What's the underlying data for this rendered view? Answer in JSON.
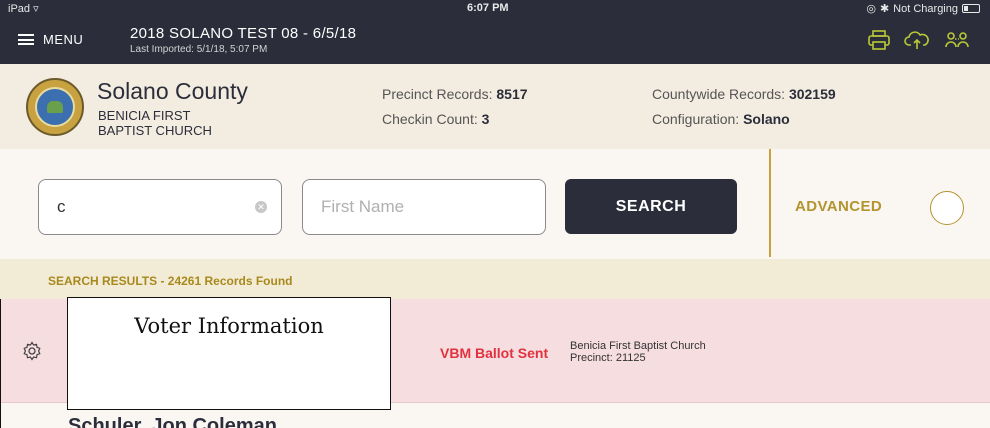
{
  "status_bar": {
    "device": "iPad",
    "time": "6:07 PM",
    "charging": "Not Charging"
  },
  "header": {
    "menu_label": "MENU",
    "election_title": "2018 SOLANO TEST 08 - 6/5/18",
    "last_imported": "Last Imported: 5/1/18, 5:07 PM",
    "icons": [
      "printer-icon",
      "cloud-upload-icon",
      "users-icon"
    ]
  },
  "county": {
    "name": "Solano County",
    "location_line1": "BENICIA FIRST",
    "location_line2": "BAPTIST CHURCH",
    "precinct_records_label": "Precinct Records:",
    "precinct_records": "8517",
    "checkin_count_label": "Checkin Count:",
    "checkin_count": "3",
    "countywide_records_label": "Countywide Records:",
    "countywide_records": "302159",
    "configuration_label": "Configuration:",
    "configuration": "Solano"
  },
  "search": {
    "last_name_value": "c",
    "first_name_placeholder": "First Name",
    "search_label": "SEARCH",
    "advanced_label": "ADVANCED"
  },
  "results": {
    "summary": "SEARCH RESULTS - 24261 Records Found",
    "rows": [
      {
        "status": "VBM Ballot Sent",
        "place": "Benicia First Baptist Church",
        "precinct": "Precinct: 21125"
      }
    ],
    "next_row_name": "Schuler, Jon Coleman"
  },
  "overlay": {
    "label": "Voter Information"
  },
  "colors": {
    "header_bg": "#2b2e3a",
    "accent_gold": "#b3942f",
    "status_red": "#e0323f",
    "row_pink": "#f6dde0",
    "icon_green": "#b9c936"
  }
}
